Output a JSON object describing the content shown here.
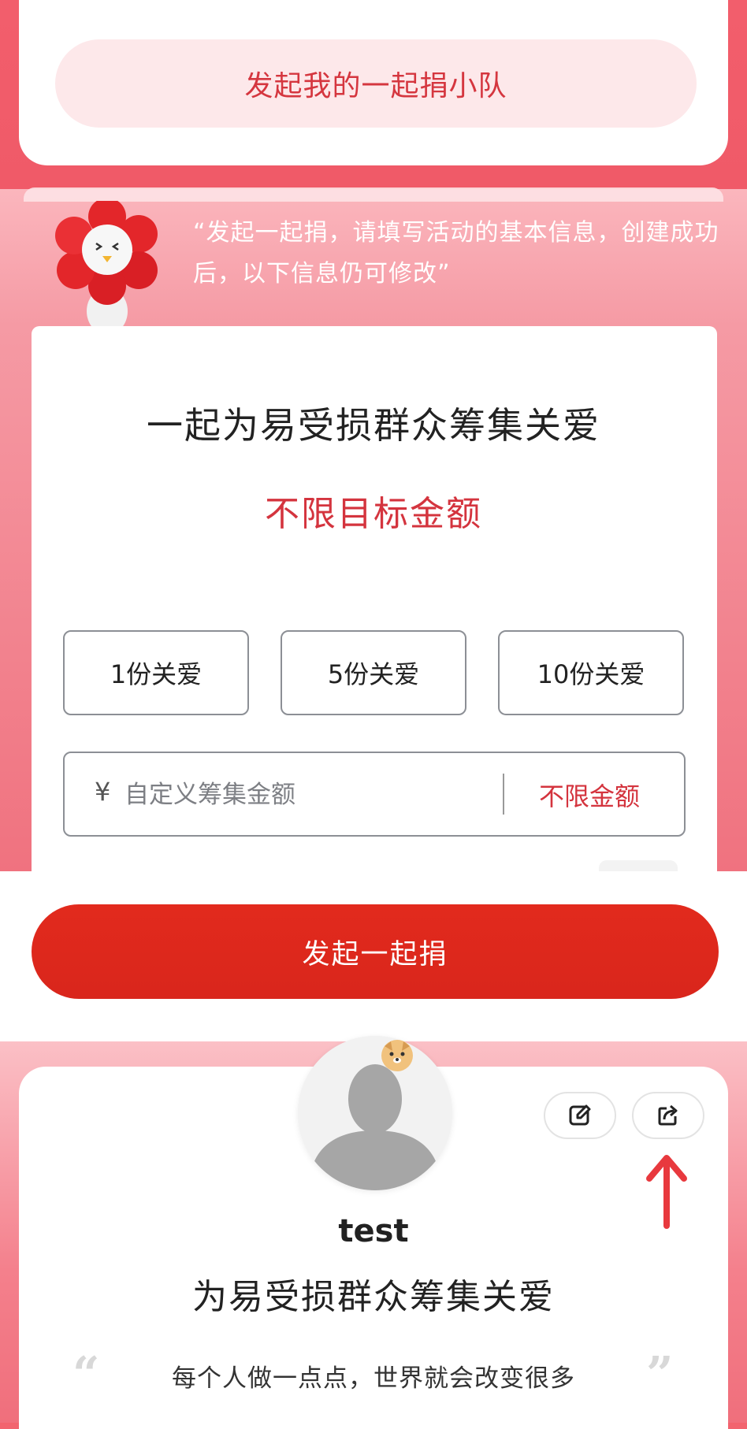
{
  "team_launch": {
    "button_label": "发起我的一起捐小队"
  },
  "intro": {
    "quote": "“发起一起捐，请填写活动的基本信息，创建成功后，以下信息仍可修改”"
  },
  "form": {
    "title": "一起为易受损群众筹集关爱",
    "subtitle": "不限目标金额",
    "options": [
      {
        "label": "1份关爱"
      },
      {
        "label": "5份关爱"
      },
      {
        "label": "10份关爱"
      }
    ],
    "currency_symbol": "¥",
    "amount_placeholder": "自定义筹集金额",
    "unlimited_label": "不限金额"
  },
  "submit": {
    "button_label": "发起一起捐"
  },
  "profile": {
    "username": "test",
    "team_title": "为易受损群众筹集关爱",
    "slogan": "每个人做一点点，世界就会改变很多",
    "open_quote": "“",
    "close_quote": "”"
  },
  "colors": {
    "brand_red": "#d9261c",
    "accent_red": "#d4343e",
    "pink_bg": "#f2646f"
  },
  "icons": {
    "edit": "edit-icon",
    "share": "share-icon",
    "arrow": "red-arrow-up-icon"
  }
}
